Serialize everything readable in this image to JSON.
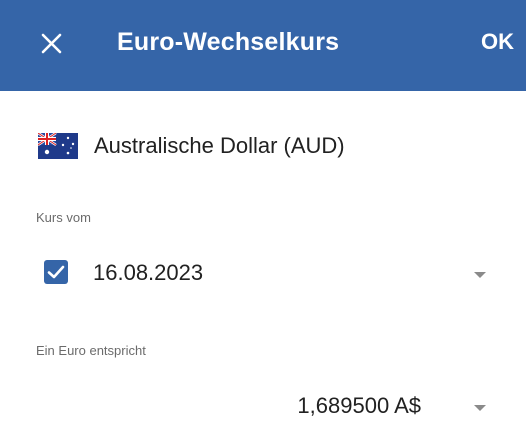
{
  "app_bar": {
    "title": "Euro-Wechselkurs",
    "ok_label": "OK",
    "close_icon": "close-icon",
    "background": "#3565a8"
  },
  "currency": {
    "name": "Australische Dollar (AUD)",
    "flag_icon": "australia-flag-icon"
  },
  "rate_date": {
    "label": "Kurs vom",
    "checked": true,
    "value": "16.08.2023",
    "dropdown_icon": "dropdown-arrow-icon"
  },
  "rate_value": {
    "label": "Ein Euro entspricht",
    "value": "1,689500 A$",
    "dropdown_icon": "dropdown-arrow-icon"
  },
  "colors": {
    "accent": "#3565a8",
    "label_gray": "#6b6b6b",
    "text": "#212121"
  }
}
